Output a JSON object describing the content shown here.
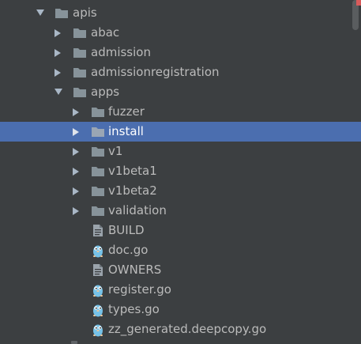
{
  "tree": {
    "items": [
      {
        "label": "apis",
        "type": "folder",
        "expanded": true
      },
      {
        "label": "abac",
        "type": "folder",
        "expanded": false
      },
      {
        "label": "admission",
        "type": "folder",
        "expanded": false
      },
      {
        "label": "admissionregistration",
        "type": "folder",
        "expanded": false
      },
      {
        "label": "apps",
        "type": "folder",
        "expanded": true
      },
      {
        "label": "fuzzer",
        "type": "folder",
        "expanded": false
      },
      {
        "label": "install",
        "type": "folder",
        "expanded": false,
        "selected": true
      },
      {
        "label": "v1",
        "type": "folder",
        "expanded": false
      },
      {
        "label": "v1beta1",
        "type": "folder",
        "expanded": false
      },
      {
        "label": "v1beta2",
        "type": "folder",
        "expanded": false
      },
      {
        "label": "validation",
        "type": "folder",
        "expanded": false
      },
      {
        "label": "BUILD",
        "type": "text-file"
      },
      {
        "label": "doc.go",
        "type": "go-file"
      },
      {
        "label": "OWNERS",
        "type": "text-file"
      },
      {
        "label": "register.go",
        "type": "go-file"
      },
      {
        "label": "types.go",
        "type": "go-file"
      },
      {
        "label": "zz_generated.deepcopy.go",
        "type": "go-file"
      }
    ]
  },
  "colors": {
    "background": "#3c3f41",
    "selection": "#4b6eaf",
    "text": "#bbbbbb",
    "folder_icon": "#87939a",
    "go_icon": "#76c2e8"
  },
  "icons": {
    "folder": "folder-icon",
    "text_file": "text-file-icon",
    "go_file": "go-gopher-icon",
    "expanded": "chevron-down-icon",
    "collapsed": "chevron-right-icon"
  }
}
